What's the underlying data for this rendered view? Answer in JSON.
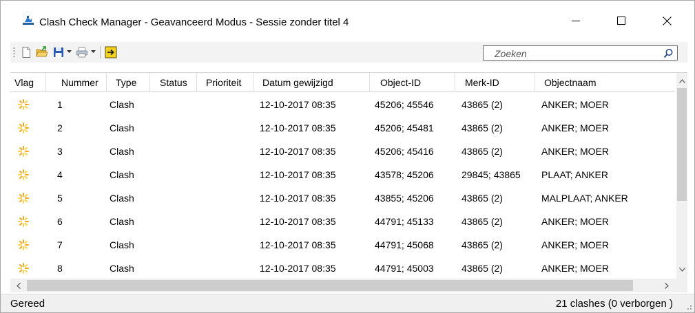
{
  "window": {
    "title": "Clash Check Manager - Geavanceerd Modus - Sessie zonder titel 4",
    "minimize_icon": "minimize-icon",
    "maximize_icon": "maximize-icon",
    "close_icon": "close-icon"
  },
  "toolbar": {
    "icons": [
      "new-document-icon",
      "open-folder-icon",
      "save-icon",
      "print-icon",
      "exit-icon"
    ],
    "search": {
      "placeholder": "Zoeken",
      "icon": "search-icon"
    }
  },
  "grid": {
    "columns": [
      "Vlag",
      "Nummer",
      "Type",
      "Status",
      "Prioriteit",
      "Datum gewijzigd",
      "Object-ID",
      "Merk-ID",
      "Objectnaam"
    ],
    "rows": [
      {
        "flag": "new-clash-icon",
        "nummer": "1",
        "type": "Clash",
        "status": "",
        "prioriteit": "",
        "datum": "12-10-2017 08:35",
        "object_id": "45206; 45546",
        "merk_id": "43865 (2)",
        "objectnaam": "ANKER; MOER"
      },
      {
        "flag": "new-clash-icon",
        "nummer": "2",
        "type": "Clash",
        "status": "",
        "prioriteit": "",
        "datum": "12-10-2017 08:35",
        "object_id": "45206; 45481",
        "merk_id": "43865 (2)",
        "objectnaam": "ANKER; MOER"
      },
      {
        "flag": "new-clash-icon",
        "nummer": "3",
        "type": "Clash",
        "status": "",
        "prioriteit": "",
        "datum": "12-10-2017 08:35",
        "object_id": "45206; 45416",
        "merk_id": "43865 (2)",
        "objectnaam": "ANKER; MOER"
      },
      {
        "flag": "new-clash-icon",
        "nummer": "4",
        "type": "Clash",
        "status": "",
        "prioriteit": "",
        "datum": "12-10-2017 08:35",
        "object_id": "43578; 45206",
        "merk_id": "29845; 43865",
        "objectnaam": "PLAAT; ANKER"
      },
      {
        "flag": "new-clash-icon",
        "nummer": "5",
        "type": "Clash",
        "status": "",
        "prioriteit": "",
        "datum": "12-10-2017 08:35",
        "object_id": "43855; 45206",
        "merk_id": "43865 (2)",
        "objectnaam": "MALPLAAT; ANKER"
      },
      {
        "flag": "new-clash-icon",
        "nummer": "6",
        "type": "Clash",
        "status": "",
        "prioriteit": "",
        "datum": "12-10-2017 08:35",
        "object_id": "44791; 45133",
        "merk_id": "43865 (2)",
        "objectnaam": "ANKER; MOER"
      },
      {
        "flag": "new-clash-icon",
        "nummer": "7",
        "type": "Clash",
        "status": "",
        "prioriteit": "",
        "datum": "12-10-2017 08:35",
        "object_id": "44791; 45068",
        "merk_id": "43865 (2)",
        "objectnaam": "ANKER; MOER"
      },
      {
        "flag": "new-clash-icon",
        "nummer": "8",
        "type": "Clash",
        "status": "",
        "prioriteit": "",
        "datum": "12-10-2017 08:35",
        "object_id": "44791; 45003",
        "merk_id": "43865 (2)",
        "objectnaam": "ANKER; MOER"
      }
    ]
  },
  "status": {
    "left": "Gereed",
    "right": "21 clashes (0 verborgen )"
  },
  "colors": {
    "flag_orange": "#f5a623",
    "flag_yellow": "#ffd24a",
    "save_blue": "#2a5bb0",
    "exit_yellow": "#f2d21b"
  }
}
